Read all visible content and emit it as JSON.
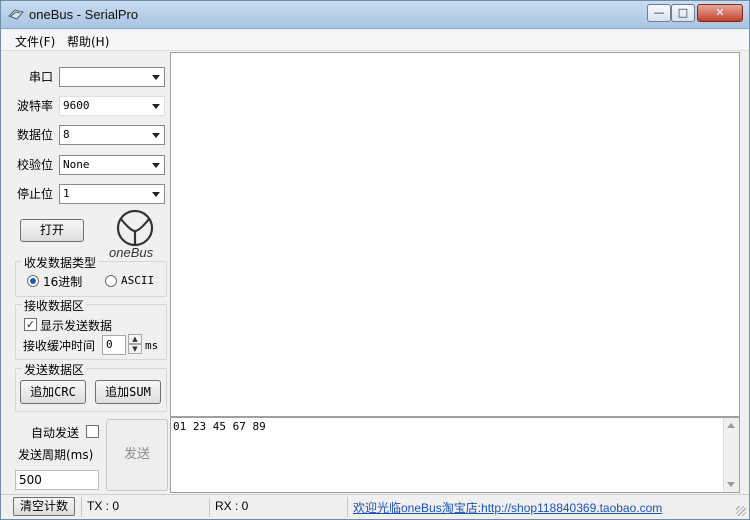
{
  "window": {
    "title": "oneBus - SerialPro"
  },
  "menu": {
    "file": "文件(F)",
    "help": "帮助(H)"
  },
  "settings": {
    "port": {
      "label": "串口",
      "value": ""
    },
    "baud": {
      "label": "波特率",
      "value": "9600"
    },
    "databits": {
      "label": "数据位",
      "value": "8"
    },
    "parity": {
      "label": "校验位",
      "value": "None"
    },
    "stopbits": {
      "label": "停止位",
      "value": "1"
    }
  },
  "open_button": "打开",
  "logo_text": "oneBus",
  "data_type": {
    "title": "收发数据类型",
    "hex_label": "16进制",
    "ascii_label": "ASCII",
    "selected": "hex"
  },
  "receive": {
    "title": "接收数据区",
    "show_sent_label": "显示发送数据",
    "show_sent_checked": true,
    "buffer_label": "接收缓冲时间",
    "buffer_value": "0",
    "buffer_unit": "ms"
  },
  "send": {
    "title": "发送数据区",
    "add_crc": "追加CRC",
    "add_sum": "追加SUM",
    "auto_send_label": "自动发送",
    "auto_send_checked": false,
    "period_label": "发送周期(ms)",
    "period_value": "500",
    "send_button": "发送",
    "content": "01 23 45 67 89"
  },
  "status": {
    "clear_button": "清空计数",
    "tx": "TX : 0",
    "rx": "RX : 0",
    "link": "欢迎光临oneBus淘宝店:http://shop118840369.taobao.com"
  }
}
